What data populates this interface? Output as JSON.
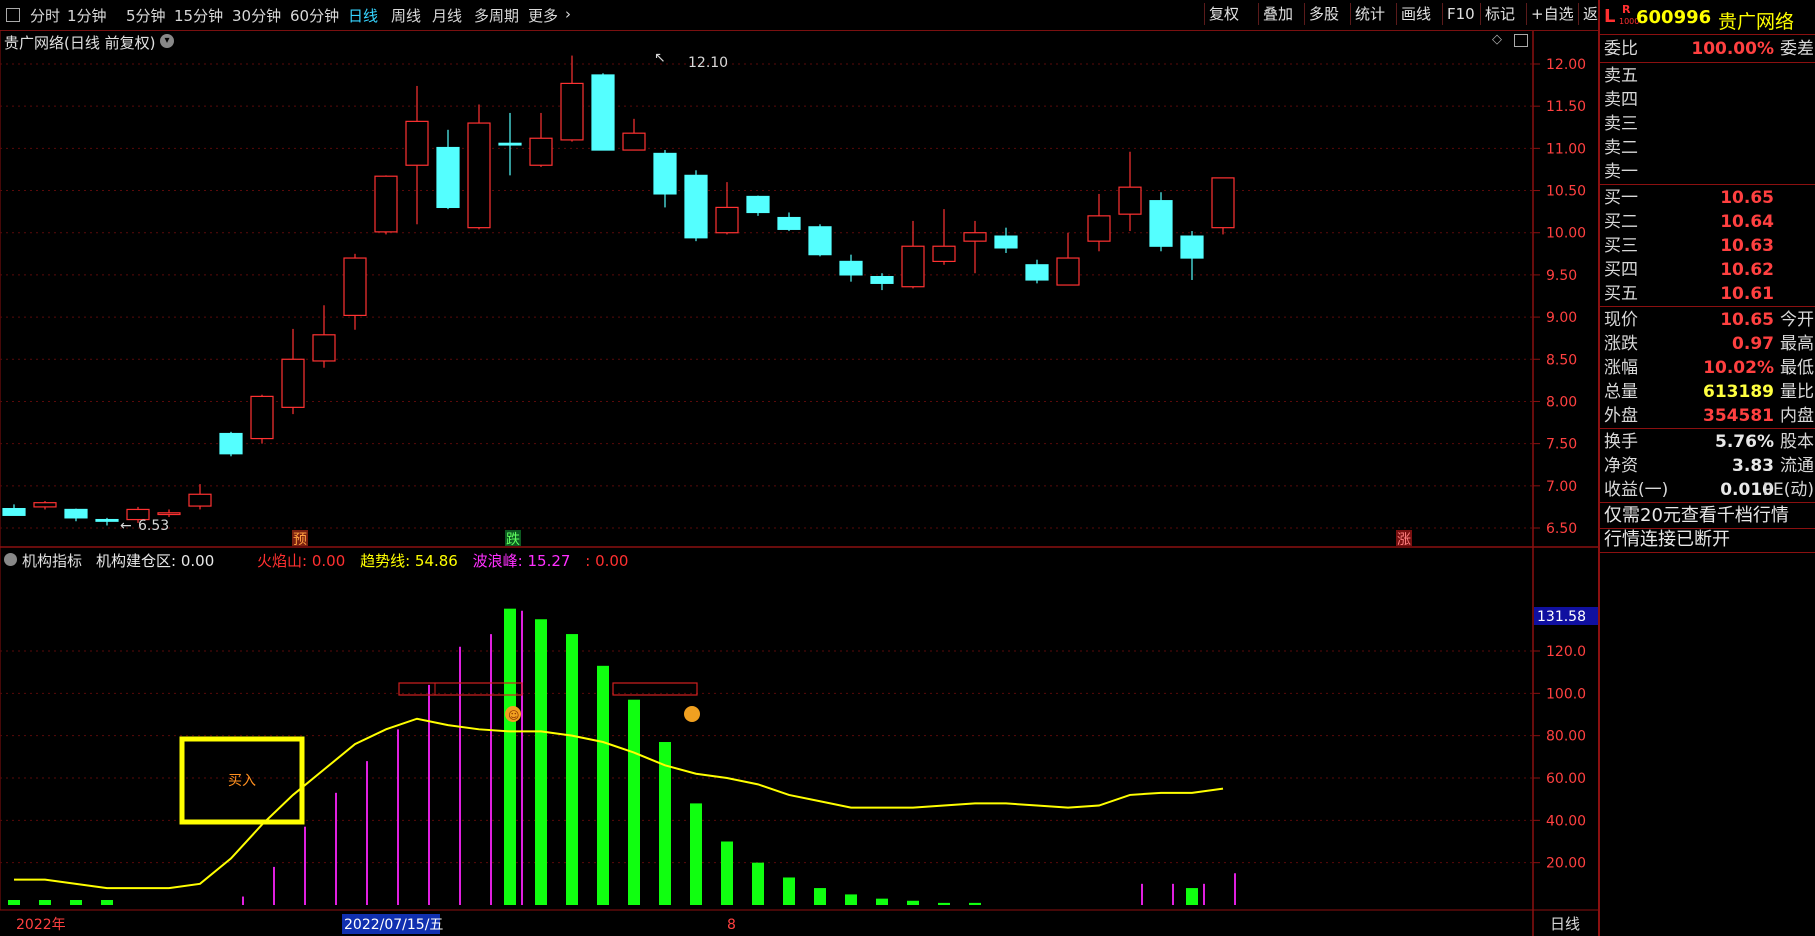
{
  "toolbar": {
    "periods": [
      "分时",
      "1分钟",
      "5分钟",
      "15分钟",
      "30分钟",
      "60分钟",
      "日线",
      "周线",
      "月线",
      "多周期",
      "更多"
    ],
    "active_period": "日线",
    "buttons": [
      "复权",
      "叠加",
      "多股",
      "统计",
      "画线",
      "F10",
      "标记",
      "+自选",
      "返回"
    ]
  },
  "chart_header": {
    "title": "贵广网络(日线 前复权)",
    "high_label": "12.10",
    "low_label": "6.53"
  },
  "price_axis": [
    "12.00",
    "11.50",
    "11.00",
    "10.50",
    "10.00",
    "9.50",
    "9.00",
    "8.50",
    "8.00",
    "7.50",
    "7.00",
    "6.50"
  ],
  "markers": {
    "pre": "预",
    "fall": "跌",
    "rise": "涨"
  },
  "indicator": {
    "name": "机构指标",
    "fields": [
      {
        "label": "机构建仓区:",
        "value": "0.00",
        "color": "#e8e8e8"
      },
      {
        "label": "火焰山:",
        "value": "0.00",
        "color": "#ff3030"
      },
      {
        "label": "趋势线:",
        "value": "54.86",
        "color": "#ffff00"
      },
      {
        "label": "波浪峰:",
        "value": "15.27",
        "color": "#ff30ff"
      },
      {
        "label": ":",
        "value": "0.00",
        "color": "#ff3030"
      }
    ],
    "axis": [
      "120.0",
      "100.0",
      "80.00",
      "60.00",
      "40.00",
      "20.00"
    ],
    "current_value": "131.58",
    "buy_label": "买入"
  },
  "date_axis": {
    "start": "2022年",
    "cursor_date": "2022/07/15/五",
    "month": "8",
    "period": "日线"
  },
  "quote": {
    "l_mark": "L",
    "r_mark": "R",
    "r_sub": "1000",
    "code": "600996",
    "name": "贵广网络",
    "weibi_label": "委比",
    "weibi_value": "100.00%",
    "weicha_label": "委差",
    "sells": [
      {
        "label": "卖五",
        "price": ""
      },
      {
        "label": "卖四",
        "price": ""
      },
      {
        "label": "卖三",
        "price": ""
      },
      {
        "label": "卖二",
        "price": ""
      },
      {
        "label": "卖一",
        "price": ""
      }
    ],
    "buys": [
      {
        "label": "买一",
        "price": "10.65"
      },
      {
        "label": "买二",
        "price": "10.64"
      },
      {
        "label": "买三",
        "price": "10.63"
      },
      {
        "label": "买四",
        "price": "10.62"
      },
      {
        "label": "买五",
        "price": "10.61"
      }
    ],
    "stats": [
      {
        "label": "现价",
        "value": "10.65",
        "tail": "今开",
        "color": "#ff4040"
      },
      {
        "label": "涨跌",
        "value": "0.97",
        "tail": "最高",
        "color": "#ff4040"
      },
      {
        "label": "涨幅",
        "value": "10.02%",
        "tail": "最低",
        "color": "#ff4040"
      },
      {
        "label": "总量",
        "value": "613189",
        "tail": "量比",
        "color": "#ffff40"
      },
      {
        "label": "外盘",
        "value": "354581",
        "tail": "内盘",
        "color": "#ff4040"
      }
    ],
    "stats2": [
      {
        "label": "换手",
        "value": "5.76%",
        "tail": "股本",
        "color": "#e8e8e8"
      },
      {
        "label": "净资",
        "value": "3.83",
        "tail": "流通",
        "color": "#e8e8e8"
      },
      {
        "label": "收益(一)",
        "value": "0.010",
        "tail": "PE(动)",
        "color": "#e8e8e8"
      }
    ],
    "promo": "仅需20元查看千档行情",
    "status": "行情连接已断开"
  },
  "chart_data": [
    {
      "type": "candlestick",
      "title": "贵广网络(日线 前复权)",
      "ylim": [
        6.4,
        12.25
      ],
      "ohlc": [
        [
          6.73,
          6.78,
          6.68,
          6.65
        ],
        [
          6.75,
          6.82,
          6.72,
          6.8
        ],
        [
          6.72,
          6.73,
          6.58,
          6.62
        ],
        [
          6.6,
          6.62,
          6.53,
          6.58
        ],
        [
          6.6,
          6.75,
          6.56,
          6.72
        ],
        [
          6.66,
          6.72,
          6.63,
          6.68
        ],
        [
          6.76,
          7.02,
          6.72,
          6.9
        ],
        [
          7.62,
          7.64,
          7.35,
          7.38
        ],
        [
          7.56,
          8.08,
          7.5,
          8.06
        ],
        [
          7.93,
          8.86,
          7.85,
          8.5
        ],
        [
          8.48,
          9.14,
          8.4,
          8.79
        ],
        [
          9.02,
          9.75,
          8.85,
          9.7
        ],
        [
          10.01,
          10.68,
          9.98,
          10.67
        ],
        [
          10.8,
          11.74,
          10.1,
          11.32
        ],
        [
          11.01,
          11.22,
          10.28,
          10.3
        ],
        [
          10.06,
          11.52,
          10.04,
          11.3
        ],
        [
          11.06,
          11.42,
          10.68,
          11.04
        ],
        [
          10.8,
          11.42,
          10.78,
          11.12
        ],
        [
          11.1,
          12.1,
          11.08,
          11.77
        ],
        [
          11.87,
          11.89,
          10.98,
          10.98
        ],
        [
          10.98,
          11.35,
          10.98,
          11.18
        ],
        [
          10.94,
          10.98,
          10.3,
          10.46
        ],
        [
          10.68,
          10.74,
          9.9,
          9.94
        ],
        [
          10.0,
          10.6,
          9.98,
          10.3
        ],
        [
          10.43,
          10.44,
          10.2,
          10.24
        ],
        [
          10.18,
          10.24,
          10.02,
          10.04
        ],
        [
          10.07,
          10.1,
          9.72,
          9.74
        ],
        [
          9.66,
          9.74,
          9.42,
          9.5
        ],
        [
          9.48,
          9.52,
          9.32,
          9.4
        ],
        [
          9.36,
          10.14,
          9.34,
          9.84
        ],
        [
          9.66,
          10.28,
          9.62,
          9.84
        ],
        [
          9.9,
          10.14,
          9.52,
          10.0
        ],
        [
          9.96,
          10.06,
          9.76,
          9.82
        ],
        [
          9.62,
          9.68,
          9.4,
          9.44
        ],
        [
          9.38,
          10.0,
          9.38,
          9.7
        ],
        [
          9.9,
          10.46,
          9.78,
          10.2
        ],
        [
          10.22,
          10.96,
          10.02,
          10.54
        ],
        [
          10.38,
          10.48,
          9.78,
          9.84
        ],
        [
          9.96,
          10.02,
          9.44,
          9.7
        ],
        [
          10.06,
          10.65,
          9.98,
          10.65
        ]
      ]
    },
    {
      "type": "bar",
      "title": "机构指标",
      "ylim": [
        0,
        150
      ],
      "series": [
        {
          "name": "火焰山",
          "values": [
            0,
            0,
            0,
            0,
            0,
            0,
            0,
            0,
            0,
            0,
            0,
            0,
            0,
            0,
            0,
            0,
            140,
            135,
            128,
            113,
            97,
            77,
            48,
            30,
            20,
            13,
            8,
            5,
            3,
            2,
            1,
            1,
            0,
            0,
            0,
            0,
            0,
            0,
            0,
            0
          ]
        },
        {
          "name": "波浪峰",
          "values": [
            0,
            0,
            0,
            0,
            0,
            0,
            0,
            4,
            18,
            37,
            53,
            68,
            83,
            104,
            122,
            128,
            139,
            0,
            0,
            0,
            0,
            0,
            0,
            0,
            0,
            0,
            0,
            0,
            0,
            0,
            0,
            0,
            0,
            0,
            0,
            0,
            10,
            10,
            10,
            15
          ]
        },
        {
          "name": "趋势线",
          "values": [
            12,
            12,
            10,
            8,
            8,
            8,
            10,
            22,
            38,
            52,
            64,
            76,
            83,
            88,
            85,
            83,
            82,
            82,
            80,
            77,
            72,
            66,
            62,
            60,
            57,
            52,
            49,
            46,
            46,
            46,
            47,
            48,
            48,
            47,
            46,
            47,
            52,
            53,
            53,
            55
          ]
        }
      ]
    }
  ]
}
